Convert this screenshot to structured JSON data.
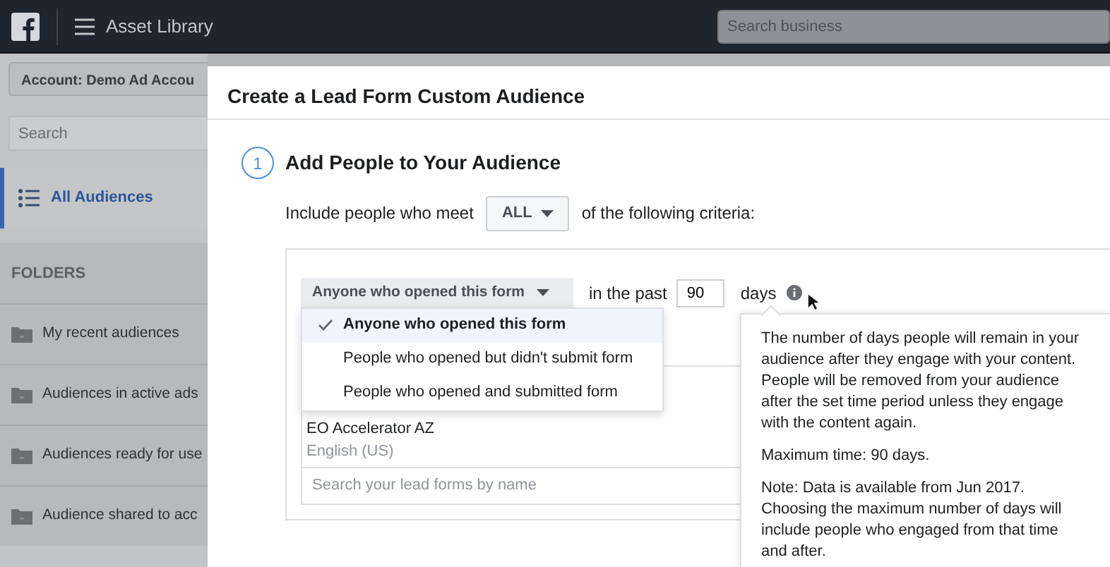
{
  "topbar": {
    "title": "Asset Library",
    "search": {
      "placeholder": "Search business"
    }
  },
  "sidebar": {
    "account": "Account: Demo Ad Accou",
    "search": {
      "placeholder": "Search"
    },
    "nav": [
      {
        "label": "All Audiences",
        "selected": true
      }
    ],
    "folders_heading": "FOLDERS",
    "folders": [
      "My recent audiences",
      "Audiences in active ads",
      "Audiences ready for use",
      "Audience shared to acc"
    ]
  },
  "modal": {
    "title": "Create a Lead Form Custom Audience",
    "step": {
      "number": "1",
      "title": "Add People to Your Audience"
    },
    "criteria_prefix": "Include people who meet",
    "match": "ALL",
    "criteria_suffix": "of the following criteria:",
    "rule": {
      "selection": "Anyone who opened this form",
      "past_label": "in the past",
      "days": "90",
      "days_label": "days",
      "options": [
        {
          "label": "Anyone who opened this form",
          "selected": true
        },
        {
          "label": "People who opened but didn't submit form",
          "selected": false
        },
        {
          "label": "People who opened and submitted form",
          "selected": false
        }
      ]
    },
    "form": {
      "name": "EO Accelerator AZ",
      "language": "English (US)",
      "search": {
        "placeholder": "Search your lead forms by name"
      }
    },
    "tooltip": [
      "The number of days people will remain in your audience after they engage with your content. People will be removed from your audience after the set time period unless they engage with the content again.",
      "Maximum time: 90 days.",
      "Note: Data is available from Jun 2017. Choosing the maximum number of days will include people who engaged from that time and after."
    ]
  }
}
